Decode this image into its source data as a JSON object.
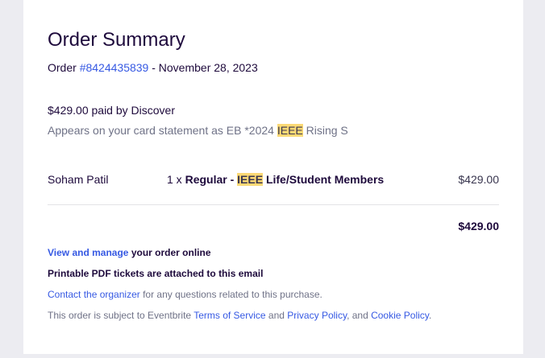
{
  "summary": {
    "title": "Order Summary",
    "order_prefix": "Order ",
    "order_number": "#8424435839",
    "order_date": " - November 28, 2023"
  },
  "payment": {
    "paid_text": "$429.00 paid by Discover",
    "statement_prefix": "Appears on your card statement as EB *2024 ",
    "statement_highlight": "IEEE",
    "statement_suffix": " Rising S"
  },
  "item": {
    "attendee": "Soham Patil",
    "quantity": "1 x ",
    "ticket_prefix": "Regular - ",
    "ticket_highlight": "IEEE",
    "ticket_suffix": " Life/Student Members",
    "price": "$429.00"
  },
  "total": "$429.00",
  "footer": {
    "manage_link": "View and manage",
    "manage_suffix": " your order online",
    "pdf_text": "Printable PDF tickets are attached to this email",
    "contact_link": "Contact the organizer",
    "contact_suffix": " for any questions related to this purchase.",
    "terms_prefix": "This order is subject to Eventbrite ",
    "terms_link": "Terms of Service",
    "and1": " and ",
    "privacy_link": "Privacy Policy",
    "and2": ", and ",
    "cookie_link": "Cookie Policy",
    "period": "."
  },
  "colors": {
    "heading": "#1e0a3c",
    "link": "#3659e3",
    "muted": "#6f7287",
    "highlight": "#fcd975",
    "page_bg": "#ececf1"
  }
}
